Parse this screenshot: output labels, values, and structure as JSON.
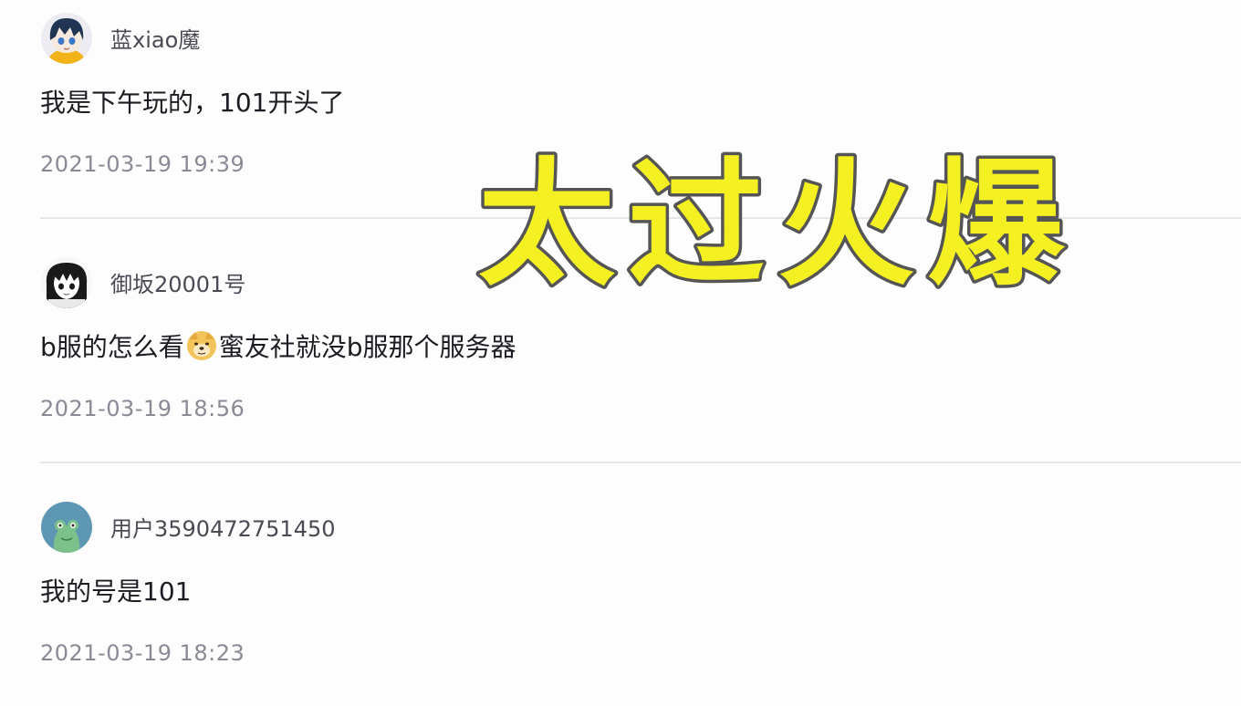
{
  "comments": [
    {
      "username": "蓝xiao魔",
      "content": "我是下午玩的，101开头了",
      "timestamp": "2021-03-19 19:39",
      "avatar_icon": "anime-avatar-blue-hair-icon"
    },
    {
      "username": "御坂20001号",
      "content_before": "b服的怎么看",
      "content_emoji": "doge-emoji-icon",
      "content_after": "蜜友社就没b服那个服务器",
      "timestamp": "2021-03-19 18:56",
      "avatar_icon": "anime-avatar-manga-girl-icon"
    },
    {
      "username": "用户3590472751450",
      "content": "我的号是101",
      "timestamp": "2021-03-19 18:23",
      "avatar_icon": "green-frog-avatar-icon"
    }
  ],
  "overlay_caption": "太过火爆",
  "colors": {
    "caption_fill": "#f4f021",
    "caption_outline": "#555555",
    "divider": "#e6e6ea",
    "timestamp": "#8a8a96"
  }
}
